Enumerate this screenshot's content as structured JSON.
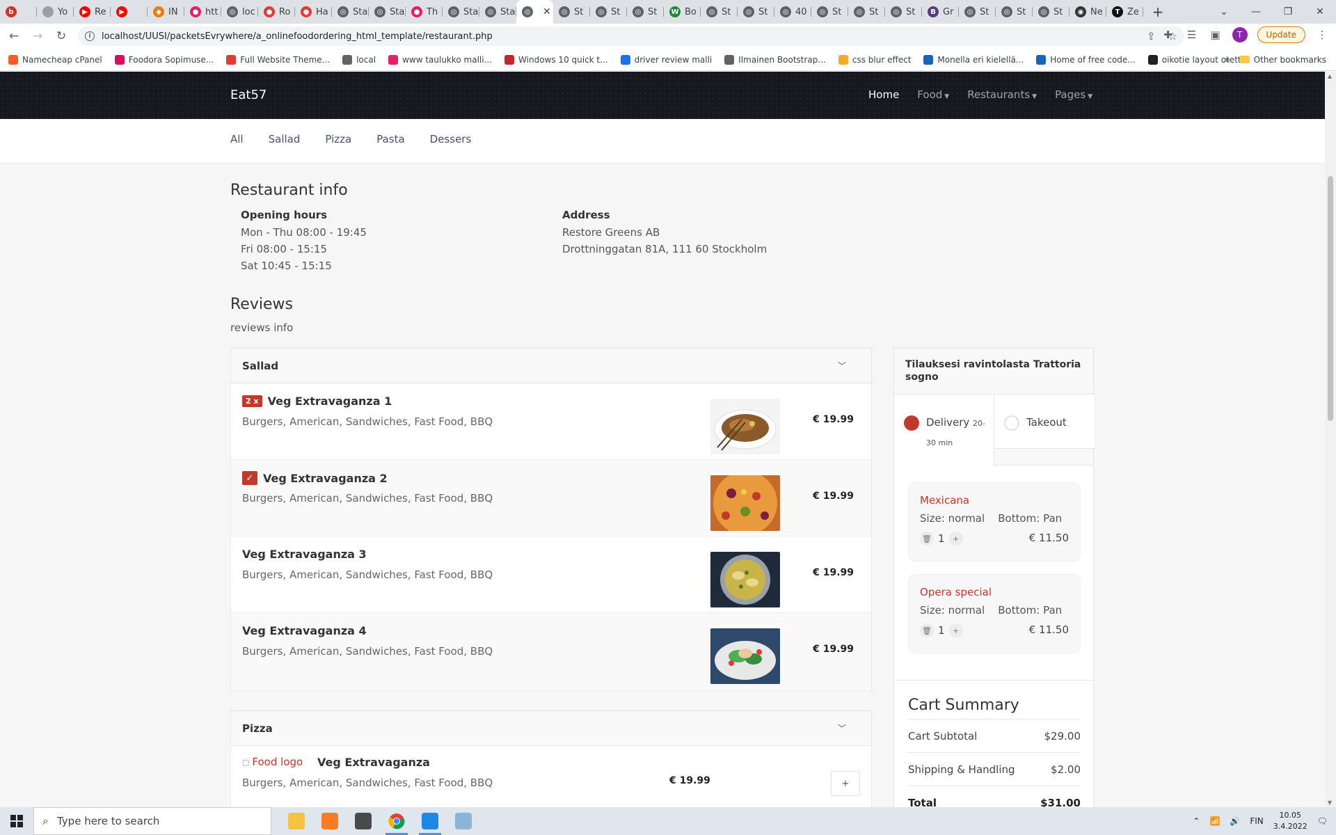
{
  "browser": {
    "tabs": [
      {
        "label": "",
        "fav_color": "#d93025",
        "fav_glyph": "b"
      },
      {
        "label": "Yo",
        "fav_color": "#9aa0a6",
        "fav_glyph": ""
      },
      {
        "label": "Re",
        "fav_color": "#ff0000",
        "fav_glyph": "▶"
      },
      {
        "label": "",
        "fav_color": "#ff0000",
        "fav_glyph": "▶"
      },
      {
        "label": "IN",
        "fav_color": "#f57c00",
        "fav_glyph": "◆"
      },
      {
        "label": "htt",
        "fav_color": "#e91e63",
        "fav_glyph": "●"
      },
      {
        "label": "loc",
        "fav_color": "#5f6368",
        "fav_glyph": "◎"
      },
      {
        "label": "Ro",
        "fav_color": "#e53935",
        "fav_glyph": "●"
      },
      {
        "label": "Ha",
        "fav_color": "#e53935",
        "fav_glyph": "●"
      },
      {
        "label": "Sta",
        "fav_color": "#5f6368",
        "fav_glyph": "◎"
      },
      {
        "label": "Sta",
        "fav_color": "#5f6368",
        "fav_glyph": "◎"
      },
      {
        "label": "Th",
        "fav_color": "#e91e63",
        "fav_glyph": "●"
      },
      {
        "label": "Sta",
        "fav_color": "#5f6368",
        "fav_glyph": "◎"
      },
      {
        "label": "Sta",
        "fav_color": "#5f6368",
        "fav_glyph": "◎"
      },
      {
        "label": "",
        "fav_color": "#5f6368",
        "fav_glyph": "◎",
        "active": true
      },
      {
        "label": "St",
        "fav_color": "#5f6368",
        "fav_glyph": "◎"
      },
      {
        "label": "St",
        "fav_color": "#5f6368",
        "fav_glyph": "◎"
      },
      {
        "label": "St",
        "fav_color": "#5f6368",
        "fav_glyph": "◎"
      },
      {
        "label": "Bo",
        "fav_color": "#1b8a3a",
        "fav_glyph": "W"
      },
      {
        "label": "St",
        "fav_color": "#5f6368",
        "fav_glyph": "◎"
      },
      {
        "label": "St",
        "fav_color": "#5f6368",
        "fav_glyph": "◎"
      },
      {
        "label": "40",
        "fav_color": "#5f6368",
        "fav_glyph": "◎"
      },
      {
        "label": "St",
        "fav_color": "#5f6368",
        "fav_glyph": "◎"
      },
      {
        "label": "St",
        "fav_color": "#5f6368",
        "fav_glyph": "◎"
      },
      {
        "label": "St",
        "fav_color": "#5f6368",
        "fav_glyph": "◎"
      },
      {
        "label": "Gr",
        "fav_color": "#563d7c",
        "fav_glyph": "B"
      },
      {
        "label": "St",
        "fav_color": "#5f6368",
        "fav_glyph": "◎"
      },
      {
        "label": "St",
        "fav_color": "#5f6368",
        "fav_glyph": "◎"
      },
      {
        "label": "St",
        "fav_color": "#5f6368",
        "fav_glyph": "◎"
      },
      {
        "label": "Ne",
        "fav_color": "#333333",
        "fav_glyph": "◉"
      },
      {
        "label": "Ze",
        "fav_color": "#111111",
        "fav_glyph": "T"
      }
    ],
    "url": "localhost/UUSI/packetsEvrywhere/a_onlinefoodordering_html_template/restaurant.php",
    "profile_initial": "T",
    "update_label": "Update",
    "bookmarks": [
      {
        "label": "Namecheap cPanel",
        "color": "#ff5a1f"
      },
      {
        "label": "Foodora Sopimuse...",
        "color": "#d70f64"
      },
      {
        "label": "Full Website Theme...",
        "color": "#e53935"
      },
      {
        "label": "local",
        "color": "#5f6368"
      },
      {
        "label": "www taulukko malli...",
        "color": "#e91e63"
      },
      {
        "label": "Windows 10 quick t...",
        "color": "#c62828"
      },
      {
        "label": "driver review malli",
        "color": "#1a73e8"
      },
      {
        "label": "Ilmainen Bootstrap...",
        "color": "#5f6368"
      },
      {
        "label": "css blur effect",
        "color": "#f9a825"
      },
      {
        "label": "Monella eri kielellä...",
        "color": "#1565c0"
      },
      {
        "label": "Home of free code...",
        "color": "#1565c0"
      },
      {
        "label": "oikotie layout otettu",
        "color": "#212121"
      }
    ],
    "other_bookmarks": "Other bookmarks"
  },
  "site": {
    "brand": "Eat57",
    "nav": [
      {
        "label": "Home",
        "active": true,
        "caret": false
      },
      {
        "label": "Food",
        "active": false,
        "caret": true
      },
      {
        "label": "Restaurants",
        "active": false,
        "caret": true
      },
      {
        "label": "Pages",
        "active": false,
        "caret": true
      }
    ],
    "categories": [
      "All",
      "Sallad",
      "Pizza",
      "Pasta",
      "Dessers"
    ]
  },
  "info": {
    "title": "Restaurant info",
    "hours_label": "Opening hours",
    "hours": [
      "Mon - Thu 08:00 - 19:45",
      "Fri 08:00 - 15:15",
      "Sat 10:45 - 15:15"
    ],
    "address_label": "Address",
    "address": [
      "Restore Greens AB",
      "Drottninggatan 81A, 111 60 Stockholm"
    ]
  },
  "reviews": {
    "title": "Reviews",
    "text": "reviews info"
  },
  "menu": {
    "sallad": {
      "title": "Sallad",
      "items": [
        {
          "name": "Veg Extravaganza 1",
          "desc": "Burgers, American, Sandwiches, Fast Food, BBQ",
          "price": "€ 19.99",
          "badge": "2 x"
        },
        {
          "name": "Veg Extravaganza 2",
          "desc": "Burgers, American, Sandwiches, Fast Food, BBQ",
          "price": "€ 19.99",
          "check": "✓"
        },
        {
          "name": "Veg Extravaganza 3",
          "desc": "Burgers, American, Sandwiches, Fast Food, BBQ",
          "price": "€ 19.99"
        },
        {
          "name": "Veg Extravaganza 4",
          "desc": "Burgers, American, Sandwiches, Fast Food, BBQ",
          "price": "€ 19.99"
        }
      ]
    },
    "pizza": {
      "title": "Pizza",
      "items": [
        {
          "img_alt": "Food logo",
          "name": "Veg Extravaganza",
          "desc": "Burgers, American, Sandwiches, Fast Food, BBQ",
          "price": "€ 19.99",
          "add": "+"
        }
      ]
    }
  },
  "order": {
    "title": "Tilauksesi ravintolasta Trattoria sogno",
    "delivery_label": "Delivery",
    "delivery_time": "20-30 min",
    "takeout_label": "Takeout",
    "cart": [
      {
        "name": "Mexicana",
        "size": "Size: normal",
        "bottom": "Bottom: Pan",
        "qty": "1",
        "price": "€ 11.50"
      },
      {
        "name": "Opera special",
        "size": "Size: normal",
        "bottom": "Bottom: Pan",
        "qty": "1",
        "price": "€ 11.50"
      }
    ],
    "summary": {
      "title": "Cart Summary",
      "subtotal_label": "Cart Subtotal",
      "subtotal": "$29.00",
      "shipping_label": "Shipping & Handling",
      "shipping": "$2.00",
      "total_label": "Total",
      "total": "$31.00"
    }
  },
  "taskbar": {
    "search_placeholder": "Type here to search",
    "lang": "FIN",
    "time": "10.05",
    "date": "3.4.2022"
  },
  "colors": {
    "accent": "#c0392b",
    "nav_bg": "#16181d",
    "link": "#4a4f70"
  }
}
